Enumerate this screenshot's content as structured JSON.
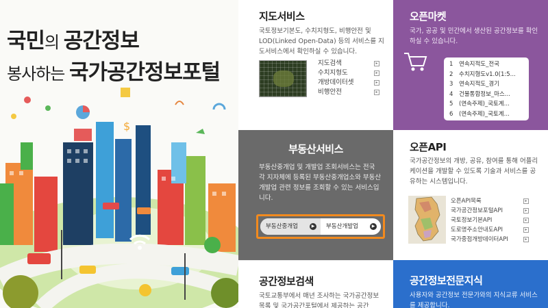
{
  "hero": {
    "line1_a": "국민",
    "line1_b": "의 ",
    "line1_c": "공간정보",
    "line2_a": "봉사하는 ",
    "line2_b": "국가공간정보포털"
  },
  "map_service": {
    "title": "지도서비스",
    "desc": "국토정보기본도, 수치지형도, 비행안전 및 LOD(Linked Open-Data) 등의 서비스를 지도서비스에서 확인하실 수 있습니다.",
    "links": [
      "지도검색",
      "수치지형도",
      "개방데이터셋",
      "비행안전"
    ]
  },
  "open_market": {
    "title": "오픈마켓",
    "desc": "국가, 공공 및 민간에서 생산된 공간정보를 확인하실 수 있습니다.",
    "items": [
      {
        "num": "1",
        "label": "연속지적도_전국"
      },
      {
        "num": "2",
        "label": "수치지형도v1.0(1:5..."
      },
      {
        "num": "3",
        "label": "연속지적도_경기"
      },
      {
        "num": "4",
        "label": "건물통합정보_마스..."
      },
      {
        "num": "5",
        "label": "(연속주제)_국토계..."
      },
      {
        "num": "6",
        "label": "(연속주제)_국토계..."
      }
    ]
  },
  "real_estate": {
    "title": "부동산서비스",
    "desc": "부동산중개업 및 개발업 조회서비스는 전국 각 지자체에 등록된 부동산중개업소와 부동산개발업 관련 정보를 조회할 수 있는 서비스입니다.",
    "buttons": [
      "부동산중개업",
      "부동산개발업"
    ]
  },
  "open_api": {
    "title": "오픈API",
    "desc": "국가공간정보의 개방, 공유, 참여를 통해 어플리케이션을 개발할 수 있도록 기술과 서비스를 공유하는 시스템입니다.",
    "links": [
      "오픈API목록",
      "국가공간정보포털API",
      "국토정보기본API",
      "도로명주소안내도API",
      "국가중점개방데이터API"
    ]
  },
  "spatial_search": {
    "title": "공간정보검색",
    "desc": "국토교통부에서 매년 조사하는 국가공간정보목록 및 국가공간포털에서 제공하는 공간"
  },
  "expert": {
    "title": "공간정보전문지식",
    "desc": "사용자와 공간정보 전문가와의 지식교류 서비스를 제공합니다."
  },
  "colors": {
    "market": "#8b569d",
    "real_estate": "#6a6a6a",
    "highlight": "#f28a1e",
    "expert": "#2b6fcc"
  }
}
